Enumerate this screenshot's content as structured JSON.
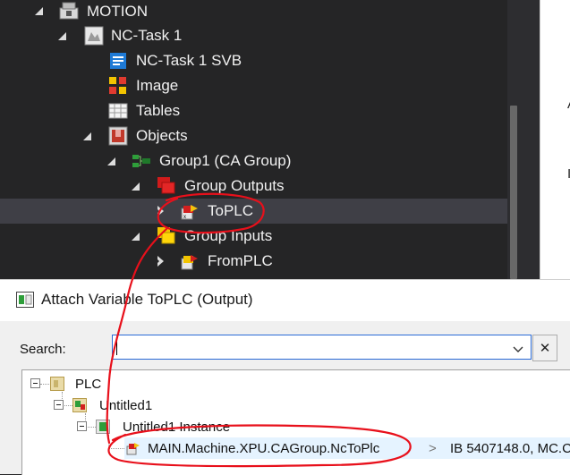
{
  "explorer": {
    "nodes": [
      {
        "label": "MOTION",
        "icon": "motion-icon",
        "expanded": true
      },
      {
        "label": "NC-Task 1",
        "icon": "nc-task-icon",
        "expanded": true
      },
      {
        "label": "NC-Task 1 SVB",
        "icon": "svb-icon"
      },
      {
        "label": "Image",
        "icon": "image-icon"
      },
      {
        "label": "Tables",
        "icon": "tables-icon"
      },
      {
        "label": "Objects",
        "icon": "objects-icon",
        "expanded": true
      },
      {
        "label": "Group1 (CA Group)",
        "icon": "ca-group-icon",
        "expanded": true
      },
      {
        "label": "Group Outputs",
        "icon": "group-outputs-icon",
        "expanded": true
      },
      {
        "label": "ToPLC",
        "icon": "output-variable-icon",
        "expanded": false,
        "selected": true
      },
      {
        "label": "Group Inputs",
        "icon": "group-inputs-icon",
        "expanded": true
      },
      {
        "label": "FromPLC",
        "icon": "input-variable-icon",
        "expanded": false
      }
    ]
  },
  "right_panel": {
    "fragment_1": "A",
    "fragment_2": "I"
  },
  "dialog": {
    "title": "Attach Variable ToPLC (Output)",
    "search_label": "Search:",
    "search_value": "",
    "clear_button_label": "✕",
    "tree": [
      {
        "label": "PLC"
      },
      {
        "label": "Untitled1"
      },
      {
        "label": "Untitled1 Instance"
      },
      {
        "label": "MAIN.Machine.XPU.CAGroup.NcToPlc",
        "type_glyph": ">",
        "address": "IB 5407148.0, MC.C"
      }
    ]
  },
  "colors": {
    "explorer_bg": "#252526",
    "selection_bg": "#3f3f46",
    "annotation": "#e8101b",
    "focus_border": "#2a6ad6"
  }
}
